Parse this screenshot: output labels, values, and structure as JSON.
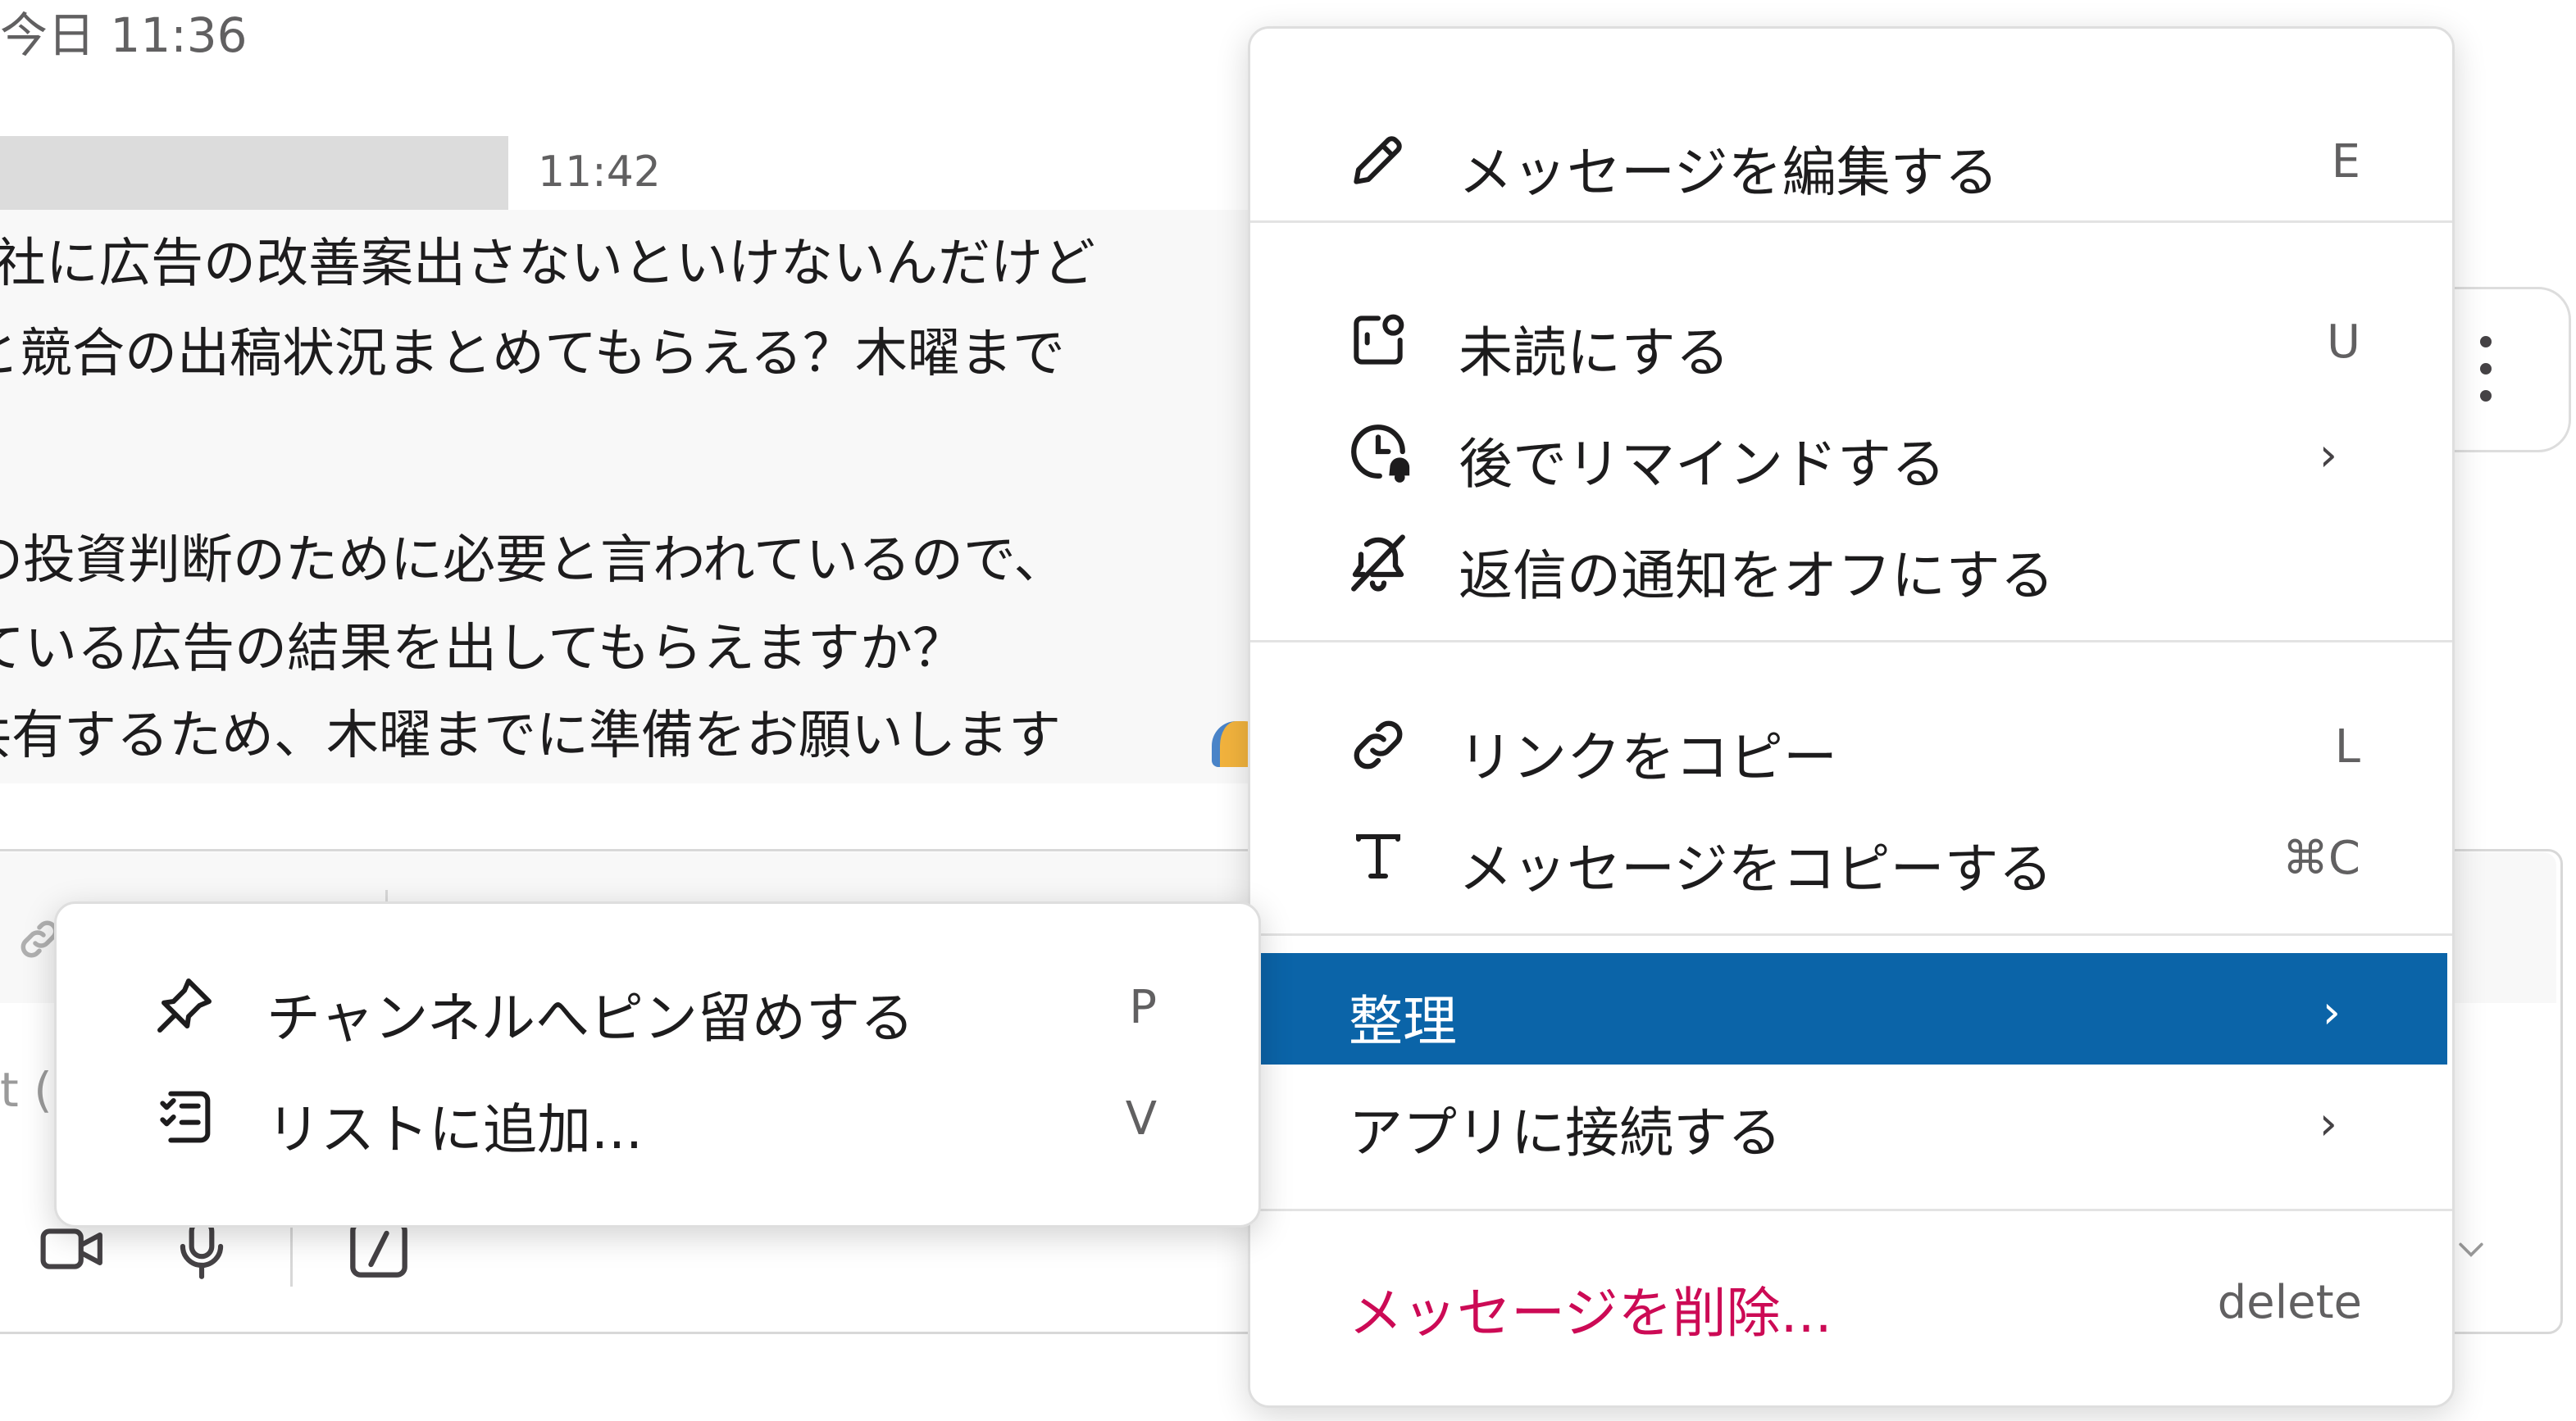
{
  "chat": {
    "date_label": "今日 11:36",
    "message_time": "11:42",
    "lines": [
      "社に広告の改善案出さないといけないんだけど",
      "と競合の出稿状況まとめてもらえる？木曜まで",
      "の投資判断のために必要と言われているので、",
      "ている広告の結果を出してもらえますか？",
      "共有するため、木曜までに準備をお願いします"
    ],
    "composer_placeholder_peek": "t ("
  },
  "menu": {
    "edit": {
      "label": "メッセージを編集する",
      "shortcut": "E",
      "icon": "pencil-icon"
    },
    "mark_unread": {
      "label": "未読にする",
      "shortcut": "U",
      "icon": "mark-unread-icon"
    },
    "remind": {
      "label": "後でリマインドする",
      "chevron": "›",
      "icon": "clock-icon"
    },
    "mute_replies": {
      "label": "返信の通知をオフにする",
      "icon": "bell-off-icon"
    },
    "copy_link": {
      "label": "リンクをコピー",
      "shortcut": "L",
      "icon": "link-icon"
    },
    "copy_message": {
      "label": "メッセージをコピーする",
      "shortcut": "⌘C",
      "icon": "text-icon"
    },
    "organize": {
      "label": "整理",
      "chevron": "›"
    },
    "connect_apps": {
      "label": "アプリに接続する",
      "chevron": "›"
    },
    "delete": {
      "label": "メッセージを削除...",
      "shortcut": "delete"
    }
  },
  "submenu": {
    "pin": {
      "label": "チャンネルへピン留めする",
      "shortcut": "P",
      "icon": "pin-icon"
    },
    "add_to_list": {
      "label": "リストに追加...",
      "shortcut": "V",
      "icon": "list-add-icon"
    }
  },
  "colors": {
    "highlight": "#0b64a8",
    "danger": "#cc0a55",
    "text": "#1d1c1d",
    "muted": "#616061"
  }
}
